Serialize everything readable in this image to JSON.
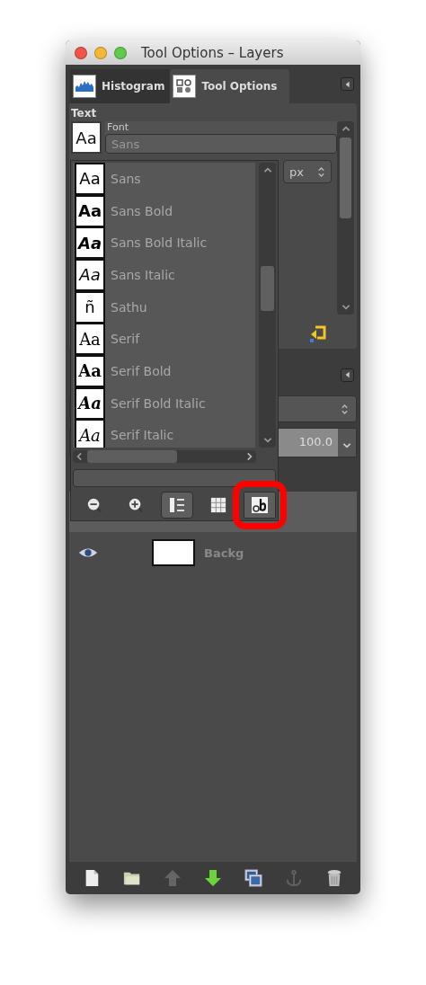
{
  "window": {
    "title": "Tool Options – Layers"
  },
  "tabs": [
    {
      "label": "Histogram",
      "kind": "histogram",
      "selected": false
    },
    {
      "label": "Tool Options",
      "kind": "tool-options",
      "selected": true
    }
  ],
  "tool_options": {
    "section": "Text",
    "font_label": "Font",
    "font_preview": "Aa",
    "font_field": {
      "value": "Sans"
    },
    "unit": "px"
  },
  "font_popup": {
    "fonts": [
      {
        "name": "Sans",
        "preview": "Aa",
        "kind": "sans",
        "bold": false,
        "italic": false
      },
      {
        "name": "Sans Bold",
        "preview": "Aa",
        "kind": "sans",
        "bold": true,
        "italic": false
      },
      {
        "name": "Sans Bold Italic",
        "preview": "Aa",
        "kind": "sans",
        "bold": true,
        "italic": true
      },
      {
        "name": "Sans Italic",
        "preview": "Aa",
        "kind": "sans",
        "bold": false,
        "italic": true
      },
      {
        "name": "Sathu",
        "preview": "ñ",
        "kind": "sans",
        "bold": false,
        "italic": false
      },
      {
        "name": "Serif",
        "preview": "Aa",
        "kind": "serif",
        "bold": false,
        "italic": false
      },
      {
        "name": "Serif Bold",
        "preview": "Aa",
        "kind": "serif",
        "bold": true,
        "italic": false
      },
      {
        "name": "Serif Bold Italic",
        "preview": "Aa",
        "kind": "serif",
        "bold": true,
        "italic": true
      },
      {
        "name": "Serif Italic",
        "preview": "Aa",
        "kind": "serif",
        "bold": false,
        "italic": true
      }
    ],
    "buttons": [
      {
        "kind": "zoom-out",
        "selected": false,
        "highlighted": false
      },
      {
        "kind": "zoom-in",
        "selected": false,
        "highlighted": false
      },
      {
        "kind": "list-view",
        "selected": true,
        "highlighted": false
      },
      {
        "kind": "grid-view",
        "selected": false,
        "highlighted": false
      },
      {
        "kind": "text-view",
        "selected": true,
        "highlighted": true
      }
    ]
  },
  "layers": {
    "opacity": "100.0",
    "rows": [
      {
        "name": "Backg",
        "visible": true
      }
    ]
  },
  "bottom_toolbar": [
    {
      "kind": "new",
      "disabled": false
    },
    {
      "kind": "open",
      "disabled": false
    },
    {
      "kind": "raise",
      "disabled": true
    },
    {
      "kind": "lower",
      "disabled": false
    },
    {
      "kind": "duplicate",
      "disabled": false
    },
    {
      "kind": "anchor",
      "disabled": true
    },
    {
      "kind": "delete",
      "disabled": false
    }
  ]
}
